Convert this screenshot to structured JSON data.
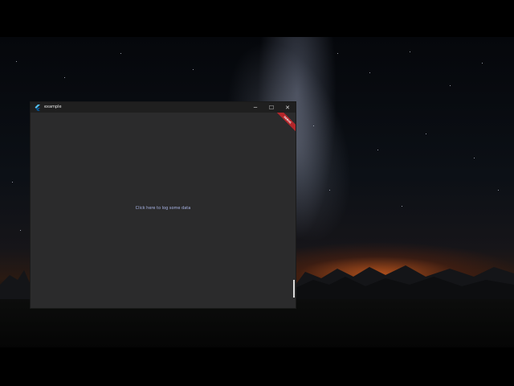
{
  "window": {
    "title": "example",
    "minimize_glyph": "─",
    "maximize_glyph": "☐",
    "close_glyph": "✕",
    "debug_banner": "DEBUG"
  },
  "content": {
    "log_button_label": "Click here to log some data"
  },
  "colors": {
    "window_bg": "#2b2b2c",
    "titlebar_bg": "#1f1f1f",
    "link_text": "#a9b4e6",
    "debug_ribbon": "#b3262a",
    "tent_green": "#7fd832"
  },
  "icons": {
    "app": "flutter-icon"
  }
}
